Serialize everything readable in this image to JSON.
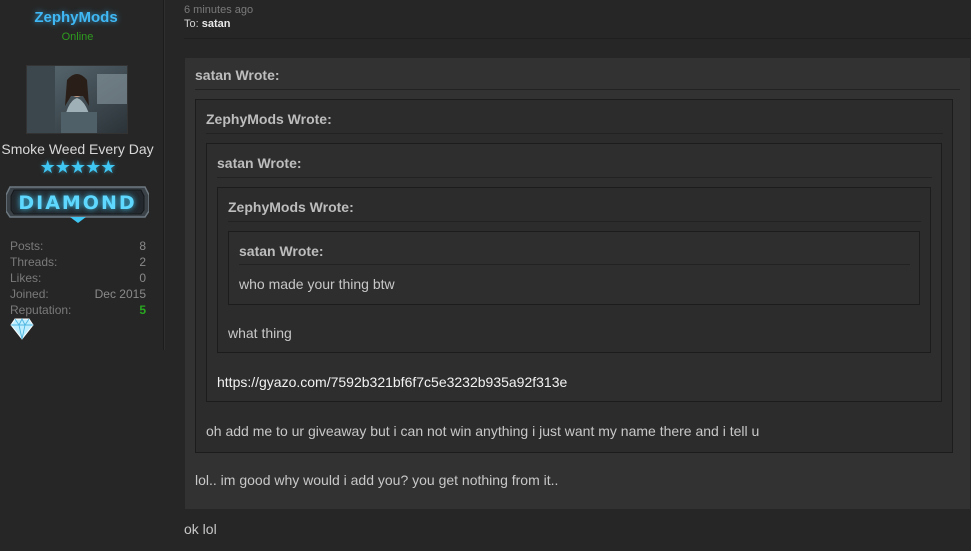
{
  "user": {
    "name": "ZephyMods",
    "status": "Online",
    "title": "Smoke Weed Every Day",
    "stars": "★★★★★",
    "rank": "DIAMOND",
    "stats": [
      {
        "label": "Posts:",
        "value": "8"
      },
      {
        "label": "Threads:",
        "value": "2"
      },
      {
        "label": "Likes:",
        "value": "0"
      },
      {
        "label": "Joined:",
        "value": "Dec 2015"
      },
      {
        "label": "Reputation:",
        "value": "5"
      }
    ]
  },
  "post": {
    "time": "6 minutes ago",
    "to_label": "To:",
    "to_user": "satan",
    "quotes": [
      {
        "author": "satan Wrote:"
      },
      {
        "author": "ZephyMods Wrote:"
      },
      {
        "author": "satan Wrote:"
      },
      {
        "author": "ZephyMods Wrote:"
      },
      {
        "author": "satan Wrote:"
      }
    ],
    "q5_text": "who made your thing btw",
    "q4_text": "what thing",
    "q3_link": "https://gyazo.com/7592b321bf6f7c5e3232b935a92f313e",
    "q2_text": "oh add me to ur giveaway but i can not win anything i just want my name there and i tell u",
    "q1_text": "lol.. im good why would i add you? you get nothing from it..",
    "reply": "ok lol"
  },
  "colors": {
    "username": "#3fb8f5",
    "online": "#2e9b1f",
    "reputation": "#29a820",
    "background": "#262626"
  }
}
